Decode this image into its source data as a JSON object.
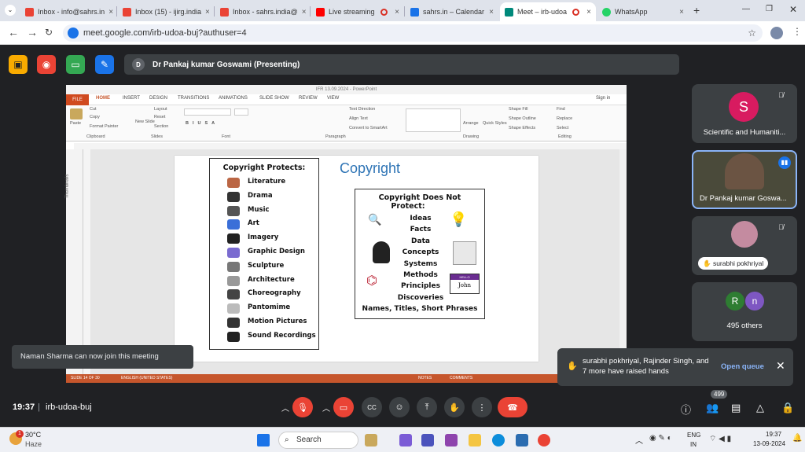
{
  "browser": {
    "tabs": [
      {
        "label": "Inbox - info@sahrs.in",
        "icon": "gmail-icon",
        "color": "#ea4335"
      },
      {
        "label": "Inbox (15) - ijirg.india",
        "icon": "gmail-icon",
        "color": "#ea4335"
      },
      {
        "label": "Inbox - sahrs.india@",
        "icon": "gmail-icon",
        "color": "#ea4335"
      },
      {
        "label": "Live streaming",
        "icon": "youtube-icon",
        "color": "#ff0000"
      },
      {
        "label": "sahrs.in – Calendar",
        "icon": "calendar-icon",
        "color": "#1a73e8"
      },
      {
        "label": "Meet – irb-udoa",
        "icon": "meet-icon",
        "color": "#00897b"
      },
      {
        "label": "WhatsApp",
        "icon": "whatsapp-icon",
        "color": "#25d366"
      }
    ],
    "url": "meet.google.com/irb-udoa-buj?authuser=4",
    "new_tab": "+"
  },
  "meet": {
    "presenter_initial": "D",
    "presenter_label": "Dr Pankaj kumar Goswami (Presenting)",
    "time": "19:37",
    "meeting_code": "irb-udoa-buj",
    "people_count": "499",
    "toast_join": "Naman Sharma can now join this meeting",
    "toast_hands": "surabhi pokhriyal, Rajinder Singh, and 7 more have raised hands",
    "open_queue": "Open queue",
    "participants": [
      {
        "name": "Scientific and Humaniti...",
        "initial": "S",
        "color": "#d81b60"
      },
      {
        "name": "Dr Pankaj kumar Goswa..."
      },
      {
        "name": "surabhi pokhriyal"
      },
      {
        "name": "495 others",
        "initials": [
          "R",
          "n"
        ],
        "colors": [
          "#2e7d32",
          "#7e57c2"
        ]
      }
    ]
  },
  "ppt": {
    "window_title": "IFR 13.09.2024 - PowerPoint",
    "file_tab": "FILE",
    "tabs": [
      "HOME",
      "INSERT",
      "DESIGN",
      "TRANSITIONS",
      "ANIMATIONS",
      "SLIDE SHOW",
      "REVIEW",
      "VIEW"
    ],
    "sign_in": "Sign in",
    "groups": [
      "Clipboard",
      "Slides",
      "Font",
      "Paragraph",
      "Drawing",
      "Editing"
    ],
    "ribbon": {
      "paste": "Paste",
      "cut": "Cut",
      "copy": "Copy",
      "format_painter": "Format Painter",
      "new_slide": "New Slide",
      "layout": "Layout",
      "reset": "Reset",
      "section": "Section",
      "text_direction": "Text Direction",
      "align_text": "Align Text",
      "convert_smartart": "Convert to SmartArt",
      "arrange": "Arrange",
      "quick_styles": "Quick Styles",
      "shape_fill": "Shape Fill",
      "shape_outline": "Shape Outline",
      "shape_effects": "Shape Effects",
      "find": "Find",
      "replace": "Replace",
      "select": "Select"
    },
    "thumbnails": "Thumbnails",
    "status": {
      "slide": "SLIDE 14 OF 30",
      "language": "ENGLISH (UNITED STATES)",
      "notes": "NOTES",
      "comments": "COMMENTS"
    },
    "slide": {
      "heading": "Copyright",
      "protects_title": "Copyright Protects:",
      "protects": [
        "Literature",
        "Drama",
        "Music",
        "Art",
        "Imagery",
        "Graphic Design",
        "Sculpture",
        "Architecture",
        "Choreography",
        "Pantomime",
        "Motion Pictures",
        "Sound Recordings"
      ],
      "not_protect_title_1": "Copyright Does Not",
      "not_protect_title_2": "Protect:",
      "not_protect": [
        "Ideas",
        "Facts",
        "Data",
        "Concepts",
        "Systems",
        "Methods",
        "Principles",
        "Discoveries"
      ],
      "not_protect_last": "Names, Titles, Short Phrases",
      "hello_tag": "HELLO",
      "name_tag": "John"
    }
  },
  "taskbar": {
    "weather_badge": "1",
    "temperature": "30°C",
    "weather": "Haze",
    "search": "Search",
    "lang_1": "ENG",
    "lang_2": "IN",
    "time": "19:37",
    "date": "13-09-2024"
  }
}
